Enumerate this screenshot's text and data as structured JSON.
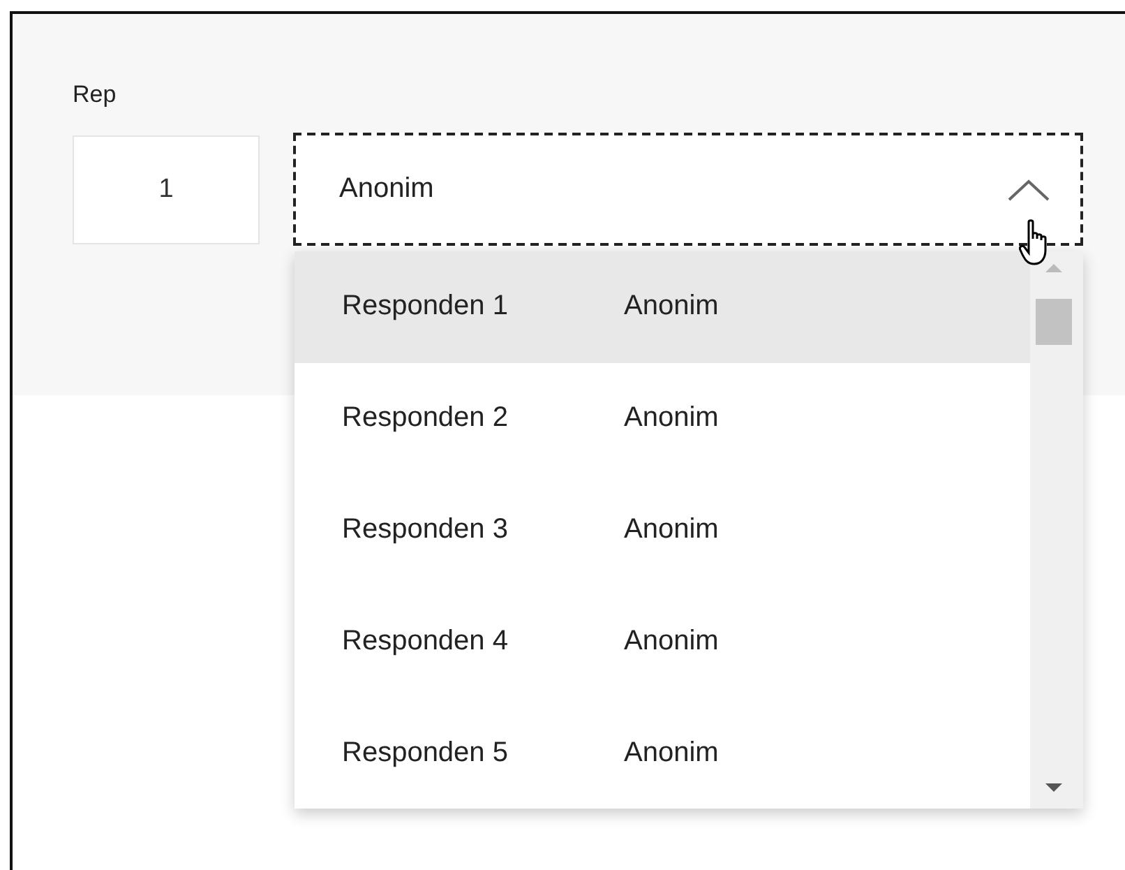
{
  "field_label": "Rep",
  "number_field": {
    "value": "1"
  },
  "select": {
    "value": "Anonim",
    "expanded": true,
    "focused": true
  },
  "options": [
    {
      "label": "Responden 1",
      "value": "Anonim",
      "selected": true
    },
    {
      "label": "Responden 2",
      "value": "Anonim",
      "selected": false
    },
    {
      "label": "Responden 3",
      "value": "Anonim",
      "selected": false
    },
    {
      "label": "Responden 4",
      "value": "Anonim",
      "selected": false
    },
    {
      "label": "Responden 5",
      "value": "Anonim",
      "selected": false
    }
  ]
}
